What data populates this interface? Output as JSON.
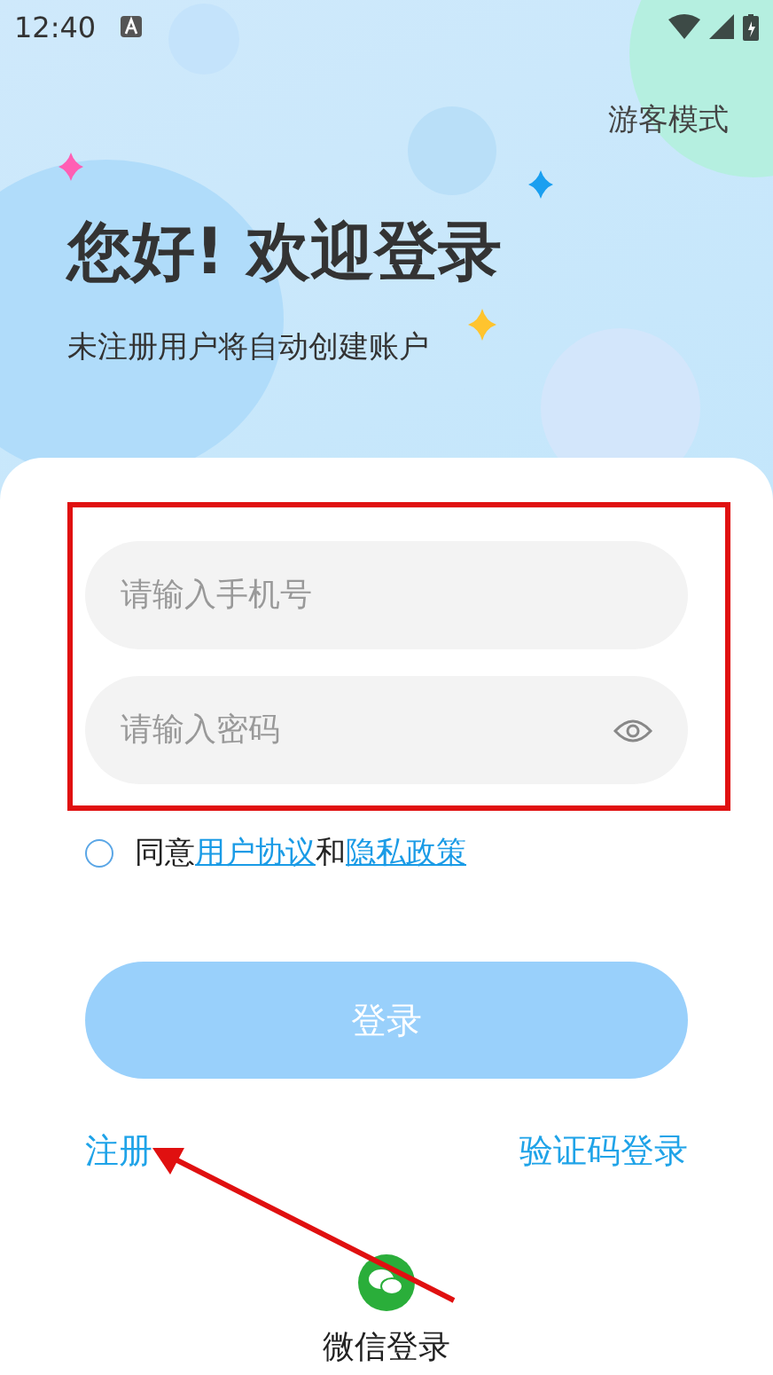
{
  "status_bar": {
    "time": "12:40"
  },
  "guest_mode": "游客模式",
  "title": "您好! 欢迎登录",
  "subtitle": "未注册用户将自动创建账户",
  "fields": [
    {
      "kind": "phone",
      "placeholder": "请输入手机号"
    },
    {
      "kind": "password",
      "placeholder": "请输入密码"
    }
  ],
  "agreement": {
    "checked": false,
    "parts": [
      {
        "kind": "text",
        "text": "同意"
      },
      {
        "kind": "link",
        "text": "用户协议"
      },
      {
        "kind": "text",
        "text": "和"
      },
      {
        "kind": "link",
        "text": "隐私政策"
      }
    ]
  },
  "login_button": {
    "label": "登录",
    "disabled": true
  },
  "links": [
    {
      "label": "注册"
    },
    {
      "label": "验证码登录"
    }
  ],
  "wechat_login": {
    "label": "微信登录"
  },
  "annotations": [
    {
      "kind": "box"
    },
    {
      "kind": "arrow"
    }
  ]
}
